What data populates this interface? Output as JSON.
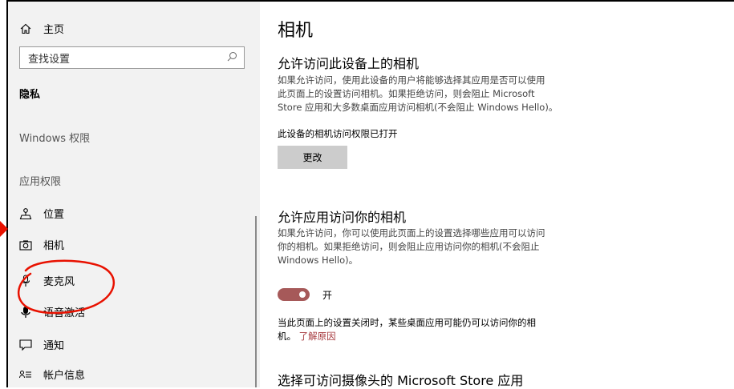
{
  "sidebar": {
    "home_label": "主页",
    "search_placeholder": "查找设置",
    "section_privacy": "隐私",
    "windows_permissions": "Windows 权限",
    "app_permissions": "应用权限",
    "items": [
      {
        "label": "位置",
        "icon": "location-icon"
      },
      {
        "label": "相机",
        "icon": "camera-icon"
      },
      {
        "label": "麦克风",
        "icon": "microphone-icon"
      },
      {
        "label": "语音激活",
        "icon": "voice-activation-icon"
      },
      {
        "label": "通知",
        "icon": "notification-icon"
      },
      {
        "label": "帐户信息",
        "icon": "account-info-icon"
      }
    ]
  },
  "main": {
    "title": "相机",
    "section1": {
      "heading": "允许访问此设备上的相机",
      "desc_l1": "如果允许访问，使用此设备的用户将能够选择其应用是否可以使用",
      "desc_l2": "此页面上的设置访问相机。如果拒绝访问，则会阻止 Microsoft",
      "desc_l3": "Store 应用和大多数桌面应用访问相机(不会阻止 Windows Hello)。",
      "status": "此设备的相机访问权限已打开",
      "change_button": "更改"
    },
    "section2": {
      "heading": "允许应用访问你的相机",
      "desc_l1": "如果允许访问，你可以使用此页面上的设置选择哪些应用可以访问",
      "desc_l2": "你的相机。如果拒绝访问，则会阻止应用访问你的相机(不会阻止",
      "desc_l3": "Windows Hello)。",
      "toggle_label": "开",
      "toggle_on": true,
      "note_l1": "当此页面上的设置关闭时，某些桌面应用可能仍可以访问你的相",
      "note_l2": "机。",
      "learn_more": "了解原因"
    },
    "section3": {
      "heading": "选择可访问摄像头的 Microsoft Store 应用"
    }
  },
  "colors": {
    "accent": "#a65959",
    "sidebar_bg": "#f2f2f2",
    "button_bg": "#cccccc",
    "annotation": "#e81100"
  }
}
